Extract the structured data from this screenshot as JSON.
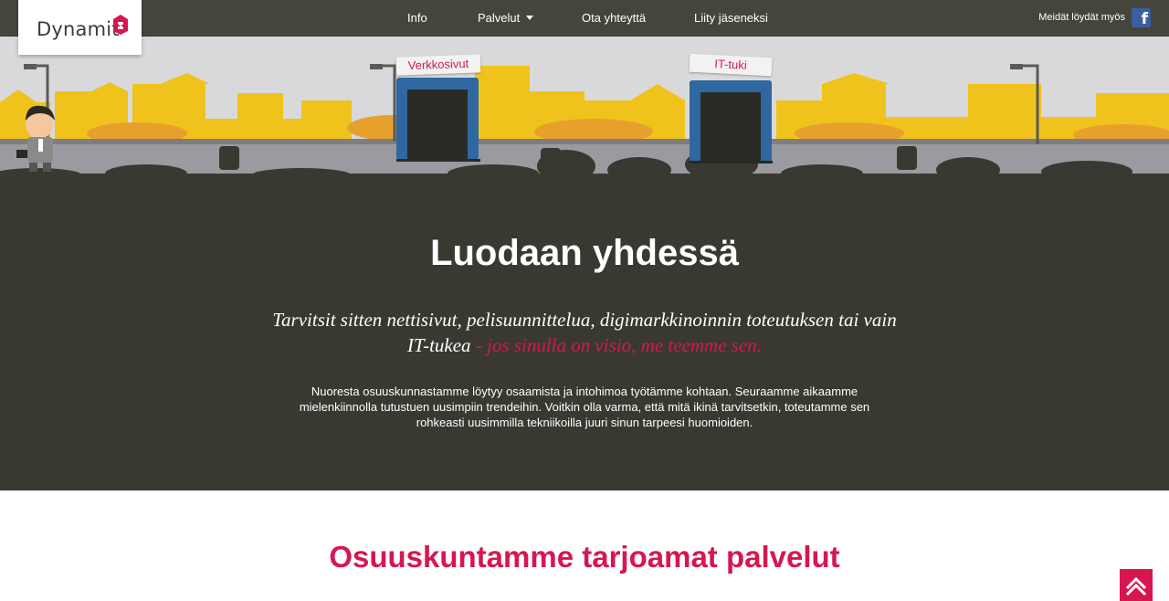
{
  "brand": {
    "logo_text": "Dynamit",
    "accent_color": "#d6174f",
    "nav_bg": "#45453c",
    "hero_bg": "#393931"
  },
  "nav": {
    "items": [
      {
        "label": "Info"
      },
      {
        "label": "Palvelut",
        "has_dropdown": true
      },
      {
        "label": "Ota yhteyttä"
      },
      {
        "label": "Liity jäseneksi"
      }
    ],
    "social_label": "Meidät löydät myös",
    "social_icon": "facebook-icon"
  },
  "scene": {
    "signs": [
      "Verkkosivut",
      "IT-tuki"
    ]
  },
  "hero": {
    "title": "Luodaan yhdessä",
    "lead": "Tarvitsit sitten nettisivut, pelisuunnittelua, digimarkkinoinnin toteutuksen tai vain IT-tukea",
    "lead_accent": " - jos sinulla on visio, me teemme sen.",
    "body": "Nuoresta osuuskunnastamme löytyy osaamista ja intohimoa työtämme kohtaan. Seuraamme aikaamme mielenkiinnolla tutustuen uusimpiin trendeihin. Voitkin olla varma, että mitä ikinä tarvitsetkin, toteutamme sen rohkeasti uusimmilla tekniikoilla juuri sinun tarpeesi huomioiden."
  },
  "services": {
    "title": "Osuuskuntamme tarjoamat palvelut"
  },
  "back_to_top_icon": "chevron-up-icon"
}
